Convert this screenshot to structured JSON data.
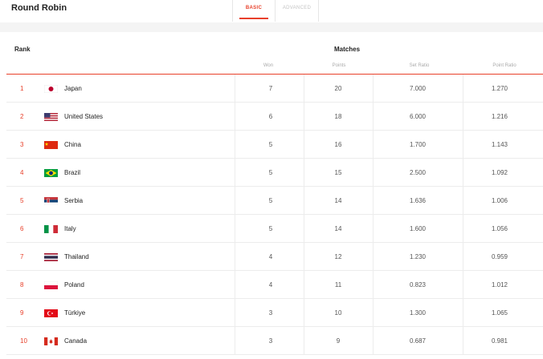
{
  "header": {
    "title": "Round Robin",
    "tabs": [
      {
        "label": "BASIC",
        "active": true
      },
      {
        "label": "ADVANCED",
        "active": false
      }
    ]
  },
  "table": {
    "rank_header": "Rank",
    "group_header": "Matches",
    "columns": [
      "Won",
      "Points",
      "Set Ratio",
      "Point Ratio"
    ],
    "accent_color": "#e8402a",
    "rows": [
      {
        "rank": "1",
        "country": "Japan",
        "flag": "japan-flag-icon",
        "won": "7",
        "points": "20",
        "set_ratio": "7.000",
        "point_ratio": "1.270"
      },
      {
        "rank": "2",
        "country": "United States",
        "flag": "united-states-flag-icon",
        "won": "6",
        "points": "18",
        "set_ratio": "6.000",
        "point_ratio": "1.216"
      },
      {
        "rank": "3",
        "country": "China",
        "flag": "china-flag-icon",
        "won": "5",
        "points": "16",
        "set_ratio": "1.700",
        "point_ratio": "1.143"
      },
      {
        "rank": "4",
        "country": "Brazil",
        "flag": "brazil-flag-icon",
        "won": "5",
        "points": "15",
        "set_ratio": "2.500",
        "point_ratio": "1.092"
      },
      {
        "rank": "5",
        "country": "Serbia",
        "flag": "serbia-flag-icon",
        "won": "5",
        "points": "14",
        "set_ratio": "1.636",
        "point_ratio": "1.006"
      },
      {
        "rank": "6",
        "country": "Italy",
        "flag": "italy-flag-icon",
        "won": "5",
        "points": "14",
        "set_ratio": "1.600",
        "point_ratio": "1.056"
      },
      {
        "rank": "7",
        "country": "Thailand",
        "flag": "thailand-flag-icon",
        "won": "4",
        "points": "12",
        "set_ratio": "1.230",
        "point_ratio": "0.959"
      },
      {
        "rank": "8",
        "country": "Poland",
        "flag": "poland-flag-icon",
        "won": "4",
        "points": "11",
        "set_ratio": "0.823",
        "point_ratio": "1.012"
      },
      {
        "rank": "9",
        "country": "Türkiye",
        "flag": "turkiye-flag-icon",
        "won": "3",
        "points": "10",
        "set_ratio": "1.300",
        "point_ratio": "1.065"
      },
      {
        "rank": "10",
        "country": "Canada",
        "flag": "canada-flag-icon",
        "won": "3",
        "points": "9",
        "set_ratio": "0.687",
        "point_ratio": "0.981"
      }
    ]
  }
}
